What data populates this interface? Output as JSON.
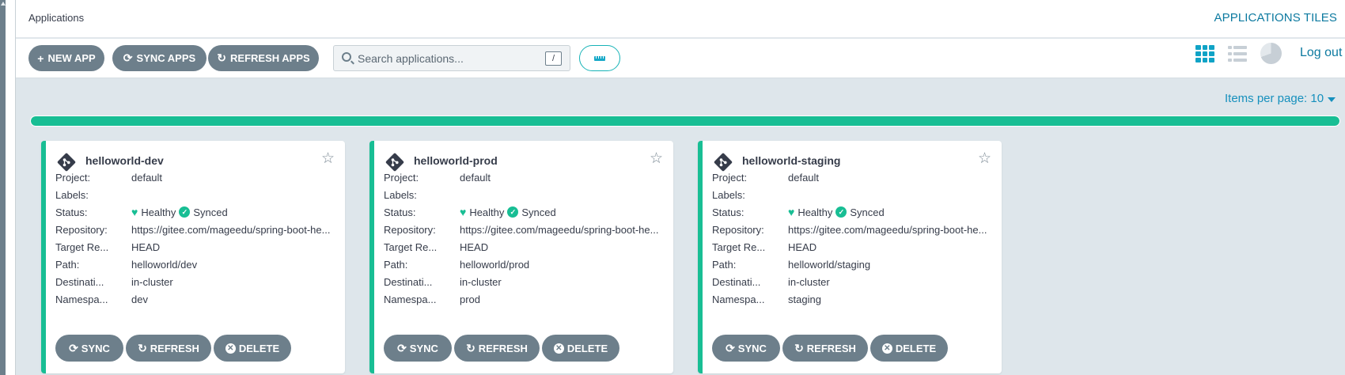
{
  "topbar": {
    "title": "Applications",
    "view_title": "APPLICATIONS TILES"
  },
  "toolbar": {
    "new_app": "NEW APP",
    "sync_apps": "SYNC APPS",
    "refresh_apps": "REFRESH APPS",
    "search_placeholder": "Search applications...",
    "search_shortcut": "/",
    "logout": "Log out"
  },
  "pagination": {
    "items_per_page_label": "Items per page: 10"
  },
  "progress": {
    "healthy_fraction": 1.0,
    "color": "#18be94"
  },
  "labels": {
    "project": "Project:",
    "labels": "Labels:",
    "status": "Status:",
    "repository": "Repository:",
    "target_revision": "Target Re...",
    "path": "Path:",
    "destination": "Destinati...",
    "namespace": "Namespa..."
  },
  "card_actions": {
    "sync": "SYNC",
    "refresh": "REFRESH",
    "delete": "DELETE"
  },
  "apps": [
    {
      "name": "helloworld-dev",
      "project": "default",
      "labels": "",
      "health": "Healthy",
      "sync": "Synced",
      "repository": "https://gitee.com/mageedu/spring-boot-he...",
      "target_revision": "HEAD",
      "path": "helloworld/dev",
      "destination": "in-cluster",
      "namespace": "dev"
    },
    {
      "name": "helloworld-prod",
      "project": "default",
      "labels": "",
      "health": "Healthy",
      "sync": "Synced",
      "repository": "https://gitee.com/mageedu/spring-boot-he...",
      "target_revision": "HEAD",
      "path": "helloworld/prod",
      "destination": "in-cluster",
      "namespace": "prod"
    },
    {
      "name": "helloworld-staging",
      "project": "default",
      "labels": "",
      "health": "Healthy",
      "sync": "Synced",
      "repository": "https://gitee.com/mageedu/spring-boot-he...",
      "target_revision": "HEAD",
      "path": "helloworld/staging",
      "destination": "in-cluster",
      "namespace": "staging"
    }
  ],
  "colors": {
    "accent": "#0d7aa0",
    "healthy": "#18be94",
    "button": "#6d7f8b"
  }
}
